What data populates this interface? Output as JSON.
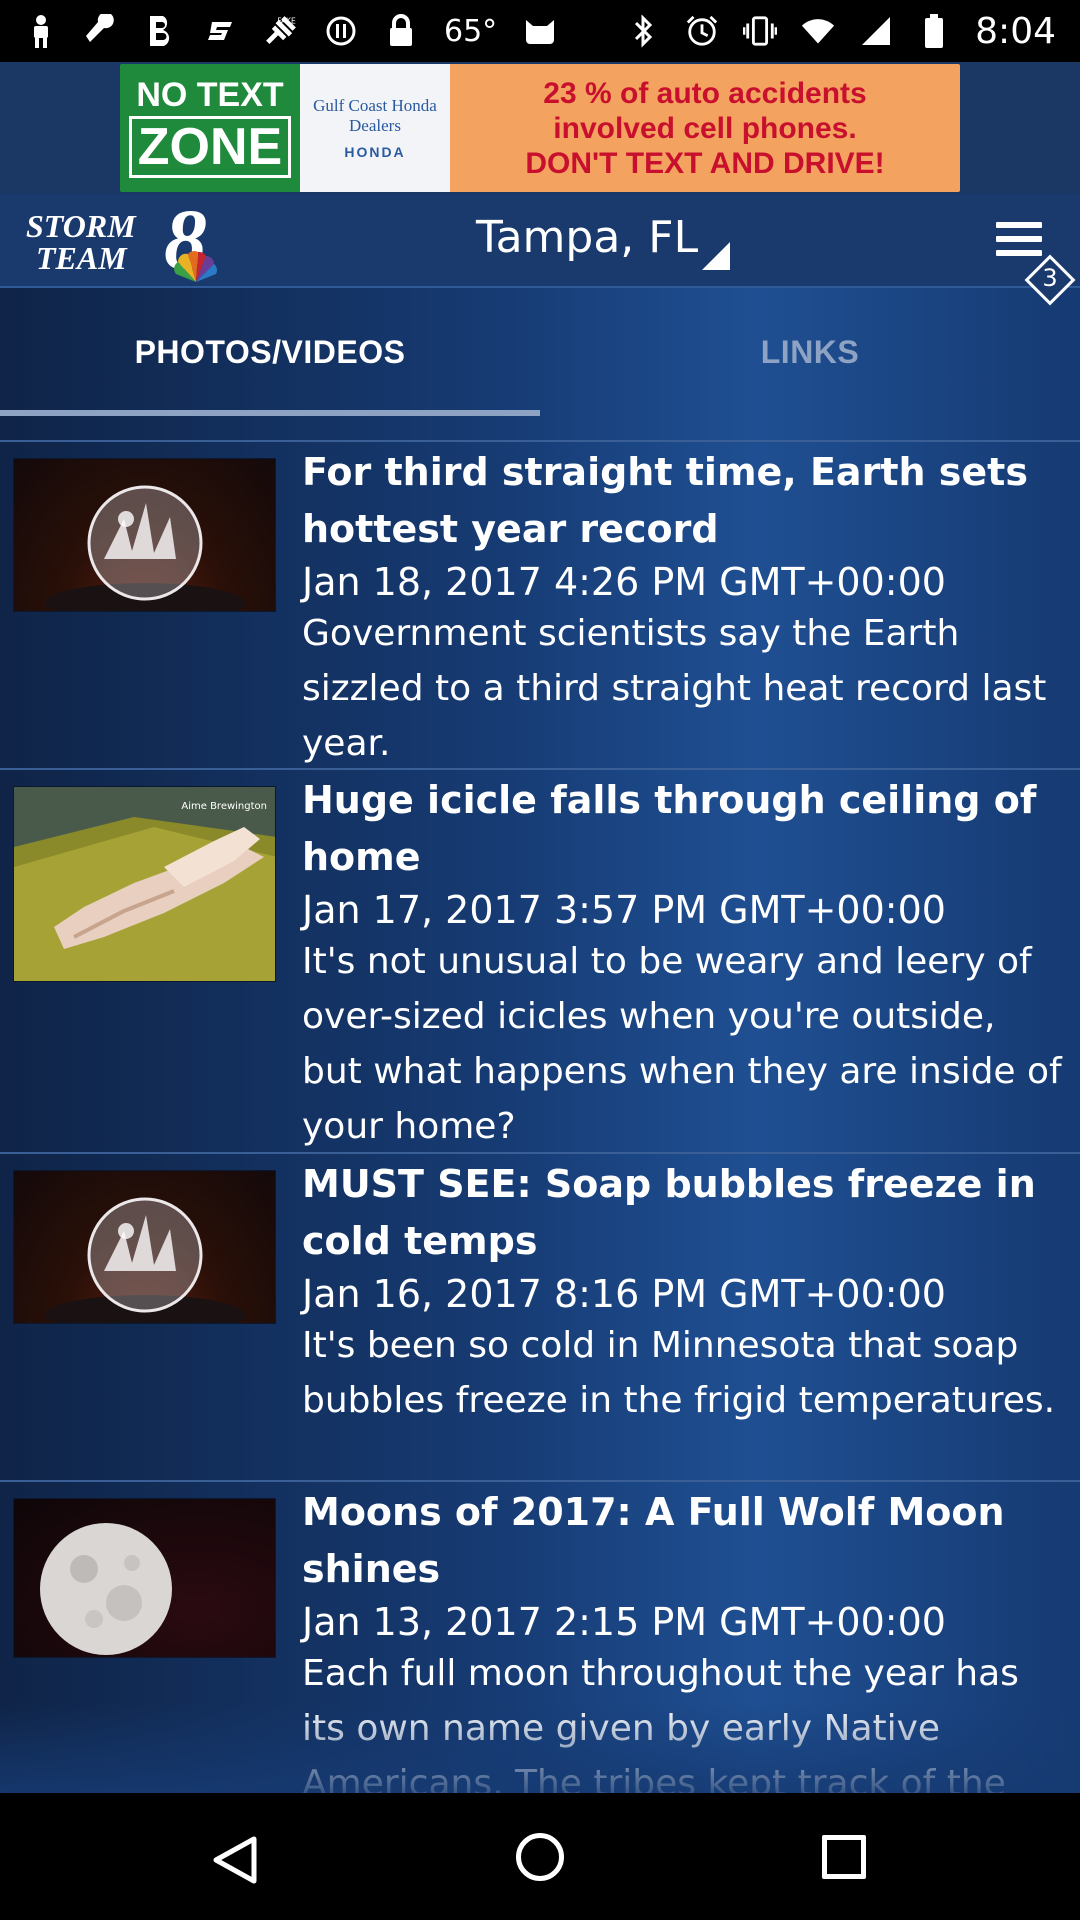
{
  "status_bar": {
    "icons_left": [
      "person-icon",
      "wrench-icon",
      "bold-b-icon",
      "s-logo-icon",
      "fake-gps-icon",
      "alert-circle-icon",
      "lock-icon"
    ],
    "temperature": "65°",
    "icons_right": [
      "bluetooth-icon",
      "alarm-icon",
      "vibrate-icon",
      "wifi-icon",
      "signal-icon",
      "battery-icon"
    ],
    "time": "8:04"
  },
  "ad": {
    "left_line1": "NO TEXT",
    "left_line2": "ZONE",
    "dealer": "Gulf Coast Honda Dealers",
    "brand": "HONDA",
    "right_line1": "23 % of auto accidents",
    "right_line2": "involved cell phones.",
    "right_line3": "DON'T TEXT AND DRIVE!"
  },
  "header": {
    "logo_line1": "STORM",
    "logo_line2": "TEAM",
    "logo_number": "8",
    "location": "Tampa, FL",
    "badge_count": "3"
  },
  "tabs": [
    {
      "label": "PHOTOS/VIDEOS",
      "active": true
    },
    {
      "label": "LINKS",
      "active": false
    }
  ],
  "articles": [
    {
      "thumb": "frozen-bubble-image",
      "headline": "For third straight time, Earth sets hottest year record",
      "date": "Jan 18, 2017 4:26 PM GMT+00:00",
      "desc": "Government scientists say the Earth sizzled to a third straight heat record last year."
    },
    {
      "thumb": "icicle-image",
      "thumb_caption": "Aime Brewington ",
      "headline": "Huge icicle falls through ceiling of home",
      "date": "Jan 17, 2017 3:57 PM GMT+00:00",
      "desc": "It's not unusual to be weary and leery of over-sized icicles when you're outside, but what happens when they are inside of your home?"
    },
    {
      "thumb": "frozen-bubble-image",
      "headline": "MUST SEE: Soap bubbles freeze in cold temps",
      "date": "Jan 16, 2017 8:16 PM GMT+00:00",
      "desc": "It's been so cold in Minnesota that soap bubbles freeze in the frigid temperatures."
    },
    {
      "thumb": "full-moon-image",
      "headline": "Moons of 2017: A Full Wolf Moon shines",
      "date": "Jan 13, 2017 2:15 PM GMT+00:00",
      "desc": "Each full moon throughout the year has its own name given by early Native Americans. The tribes kept track of the"
    }
  ],
  "colors": {
    "header_bg": "#1a3a6e",
    "list_bg": "#163a72",
    "divider": "#3a5f97",
    "inactive_tab": "#8ea3c4"
  }
}
